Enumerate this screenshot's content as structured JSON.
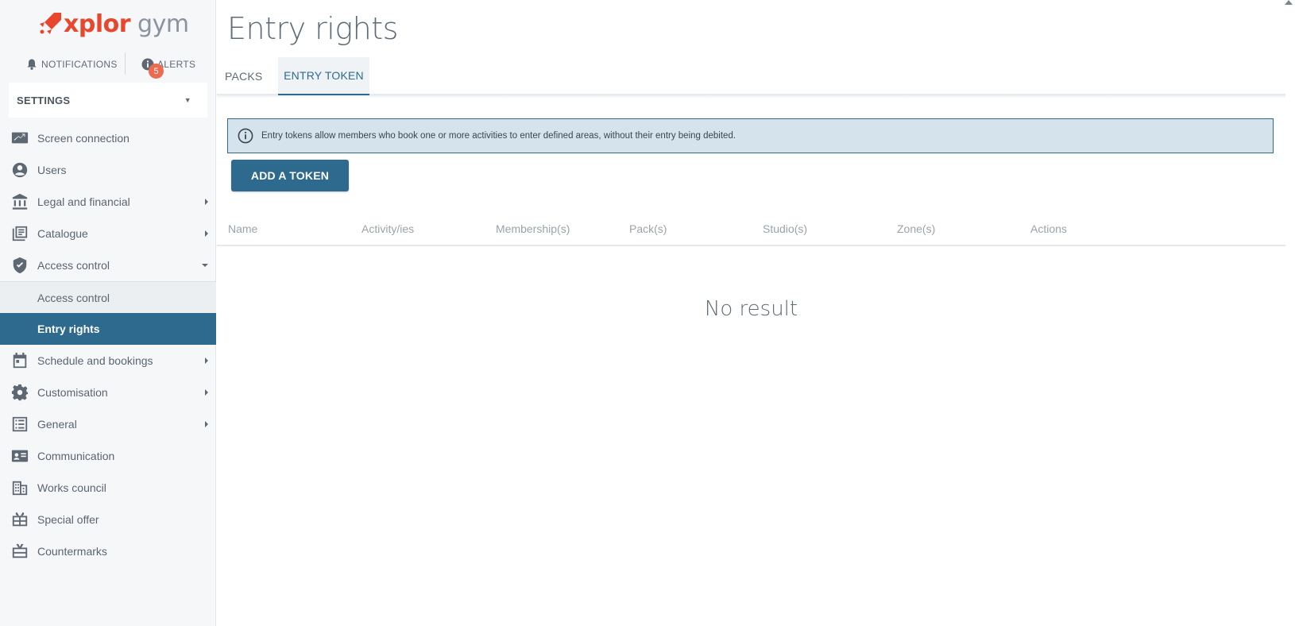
{
  "brand": {
    "name_part1": "xplor",
    "name_part2": " gym",
    "accent": "#e8472d"
  },
  "topbar": {
    "notifications_label": "NOTIFICATIONS",
    "alerts_label": "ALERTS",
    "alerts_count": "5"
  },
  "settings_select": {
    "value": "SETTINGS"
  },
  "sidebar": {
    "items": [
      {
        "label": "Screen connection",
        "icon": "screen-connection-icon"
      },
      {
        "label": "Users",
        "icon": "user-icon"
      },
      {
        "label": "Legal and financial",
        "icon": "bank-icon"
      },
      {
        "label": "Catalogue",
        "icon": "catalogue-icon"
      },
      {
        "label": "Access control",
        "icon": "shield-check-icon"
      }
    ],
    "sub_items": [
      {
        "label": "Access control"
      },
      {
        "label": "Entry rights"
      }
    ],
    "items_after": [
      {
        "label": "Schedule and bookings",
        "icon": "calendar-icon"
      },
      {
        "label": "Customisation",
        "icon": "gear-icon"
      },
      {
        "label": "General",
        "icon": "list-icon"
      },
      {
        "label": "Communication",
        "icon": "contact-card-icon"
      },
      {
        "label": "Works council",
        "icon": "building-icon"
      },
      {
        "label": "Special offer",
        "icon": "gift-icon"
      },
      {
        "label": "Countermarks",
        "icon": "countermarks-icon"
      }
    ]
  },
  "main": {
    "title": "Entry rights",
    "tabs": [
      {
        "label": "PACKS"
      },
      {
        "label": "ENTRY TOKEN"
      }
    ],
    "info_text": "Entry tokens allow members who book one or more activities to enter defined areas, without their entry being debited.",
    "add_button": "ADD A TOKEN",
    "table_headers": [
      "Name",
      "Activity/ies",
      "Membership(s)",
      "Pack(s)",
      "Studio(s)",
      "Zone(s)",
      "Actions"
    ],
    "empty_text": "No result"
  },
  "colors": {
    "primary": "#2e6a8e",
    "info_bg": "#d5e3ec",
    "badge": "#ee6a4f"
  }
}
